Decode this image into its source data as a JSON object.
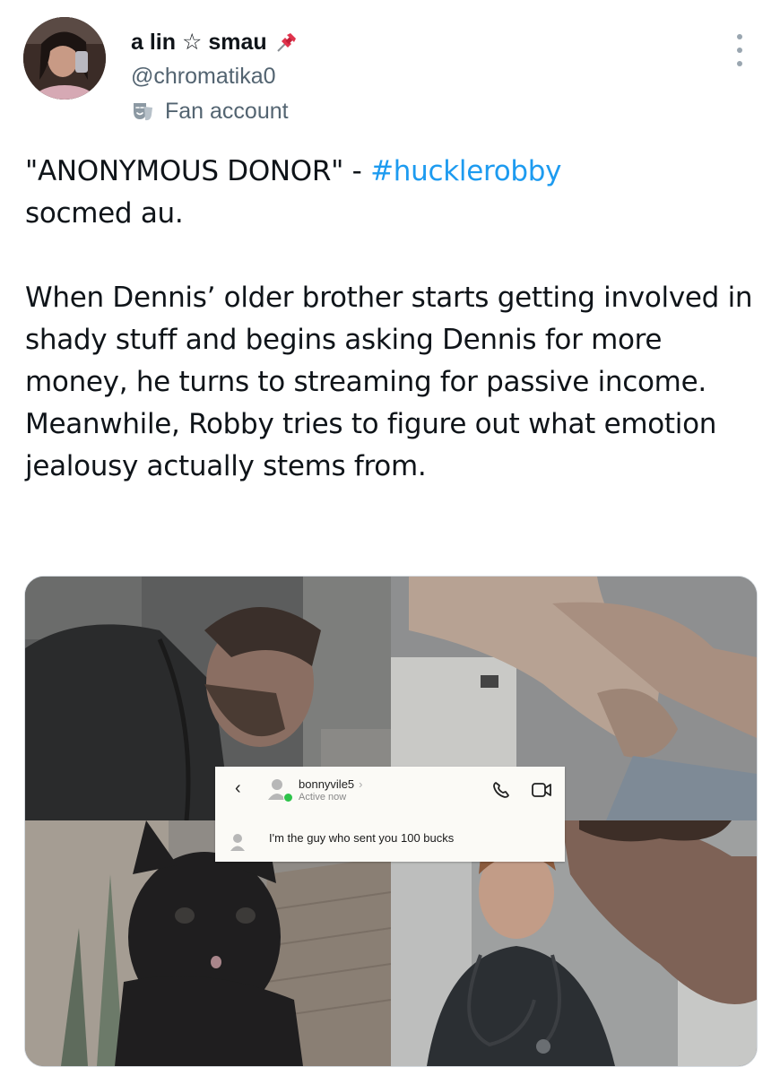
{
  "author": {
    "display_name": "a lin ☆ smau",
    "handle": "@chromatika0",
    "label": "Fan account",
    "label_icon": "theater-masks-icon",
    "name_emoji_icon": "pushpin-icon"
  },
  "menu": {
    "icon": "more-vertical-icon"
  },
  "tweet": {
    "line1_prefix": "\"ANONYMOUS DONOR\" - ",
    "hashtag": "#hucklerobby",
    "line1_suffix": "socmed au.",
    "paragraph2": "When Dennis’ older brother starts getting involved in shady stuff and begins asking Dennis for more money, he turns to streaming for passive income. Meanwhile, Robby tries to figure out what emotion jealousy actually stems from."
  },
  "media": {
    "dm": {
      "back_icon": "chevron-left-icon",
      "username": "bonnyvile5",
      "username_chevron": "›",
      "status": "Active now",
      "call_icon": "phone-icon",
      "video_icon": "video-camera-icon",
      "message": "I'm the guy who sent you 100 bucks"
    }
  },
  "colors": {
    "hashtag": "#1d9bf0",
    "secondary_text": "#536471",
    "active_dot": "#2ec34a"
  }
}
